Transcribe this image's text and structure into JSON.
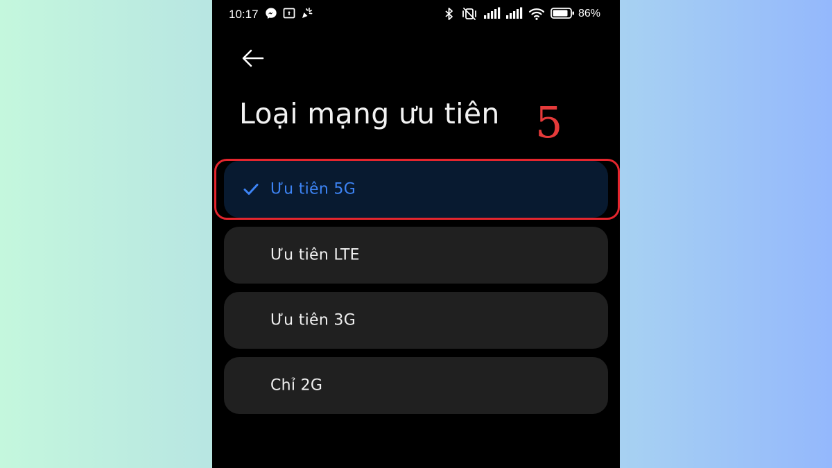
{
  "status_bar": {
    "time": "10:17",
    "battery": "86%",
    "left_icons": [
      "messenger-icon",
      "screenshot-icon",
      "notification-icon"
    ],
    "right_icons": [
      "bluetooth-icon",
      "vibrate-off-icon",
      "signal-icon",
      "signal-icon",
      "wifi-icon",
      "battery-icon"
    ]
  },
  "header": {
    "back_icon": "back-arrow-icon",
    "title": "Loại mạng ưu tiên"
  },
  "annotation": {
    "step": "5",
    "color": "#e53a3a"
  },
  "options": [
    {
      "label": "Ưu tiên 5G",
      "selected": true
    },
    {
      "label": "Ưu tiên LTE",
      "selected": false
    },
    {
      "label": "Ưu tiên 3G",
      "selected": false
    },
    {
      "label": "Chỉ 2G",
      "selected": false
    }
  ],
  "colors": {
    "accent": "#3d84f5",
    "selected_bg": "#081a30",
    "option_bg": "#202020",
    "highlight": "#e4262e"
  }
}
